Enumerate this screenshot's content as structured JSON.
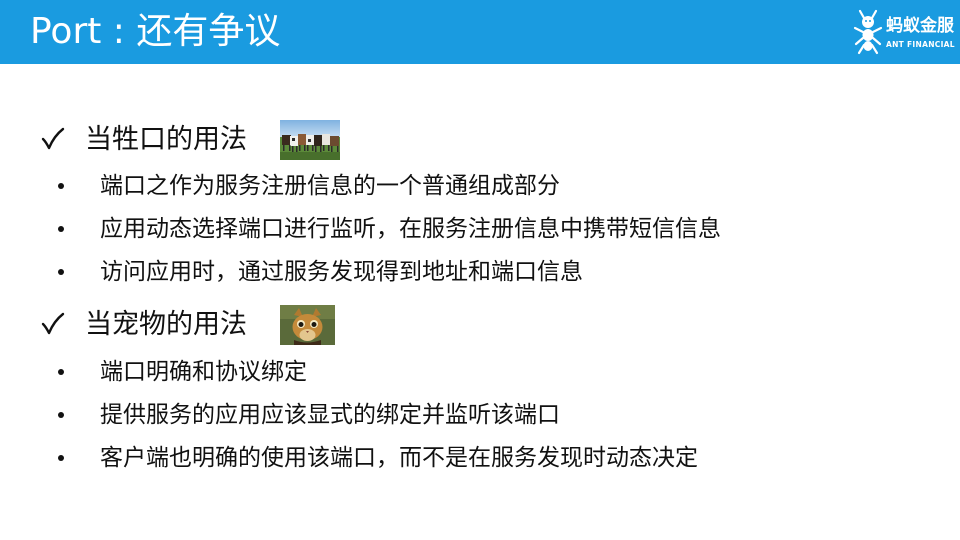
{
  "header": {
    "title": "Port : 还有争议",
    "bg_color": "#1a9be0",
    "logo": {
      "icon": "ant-logo-icon",
      "name_cn": "蚂蚁金服",
      "name_en": "ANT FINANCIAL"
    }
  },
  "sections": [
    {
      "check_icon": "check-icon",
      "title": "当牲口的用法",
      "image": "cattle-herd-image",
      "bullets": [
        "端口之作为服务注册信息的一个普通组成部分",
        "应用动态选择端口进行监听，在服务注册信息中携带短信信息",
        "访问应用时，通过服务发现得到地址和端口信息"
      ]
    },
    {
      "check_icon": "check-icon",
      "title": "当宠物的用法",
      "image": "cat-pet-image",
      "bullets": [
        "端口明确和协议绑定",
        "提供服务的应用应该显式的绑定并监听该端口",
        "客户端也明确的使用该端口，而不是在服务发现时动态决定"
      ]
    }
  ]
}
